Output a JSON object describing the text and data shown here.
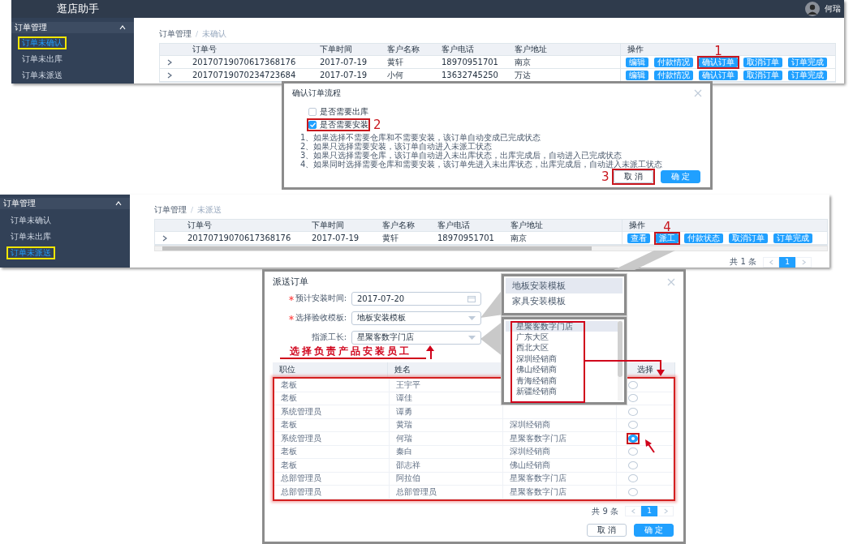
{
  "order_screen": {
    "app_title": "逛店助手",
    "user_name": "何瑞",
    "sidebar": {
      "group": "订单管理",
      "expanded": true,
      "items": [
        {
          "label": "订单未确认",
          "selected": true
        },
        {
          "label": "订单未出库",
          "selected": false
        },
        {
          "label": "订单未派送",
          "selected": false
        }
      ]
    },
    "breadcrumb": {
      "items": [
        "订单管理",
        "未确认"
      ],
      "separator": "/"
    },
    "columns": [
      "订单号",
      "下单时间",
      "客户名称",
      "客户电话",
      "客户地址",
      "操作"
    ],
    "rows": [
      {
        "order_no": "20170719070617368176",
        "date": "2017-07-19",
        "customer": "黄轩",
        "phone": "18970951701",
        "address": "南京",
        "actions": [
          {
            "label": "编辑",
            "highlighted": false
          },
          {
            "label": "付款情况",
            "highlighted": false
          },
          {
            "label": "确认订单",
            "highlighted": true,
            "step": "1"
          },
          {
            "label": "取消订单",
            "highlighted": false
          },
          {
            "label": "订单完成",
            "highlighted": false
          }
        ]
      },
      {
        "order_no": "20170719070234723684",
        "date": "2017-07-19",
        "customer": "小何",
        "phone": "13632745250",
        "address": "万达",
        "actions": [
          {
            "label": "编辑",
            "highlighted": false
          },
          {
            "label": "付款情况",
            "highlighted": false
          },
          {
            "label": "确认订单",
            "highlighted": false
          },
          {
            "label": "取消订单",
            "highlighted": false
          },
          {
            "label": "订单完成",
            "highlighted": false
          }
        ]
      }
    ]
  },
  "confirm_dialog": {
    "title": "确认订单流程",
    "options": [
      {
        "label": "是否需要出库",
        "checked": false,
        "highlighted": false
      },
      {
        "label": "是否需要安装",
        "checked": true,
        "highlighted": true,
        "step": "2"
      }
    ],
    "notes": [
      "1、如果选择不需要仓库和不需要安装，该订单自动变成已完成状态",
      "2、如果只选择需要安装，该订单自动进入未派工状态",
      "3、如果只选择需要仓库，该订单自动进入未出库状态，出库完成后，自动进入已完成状态",
      "4、如果同时选择需要仓库和需要安装，该订单先进入未出库状态，出库完成后，自动进入未派工状态"
    ],
    "buttons": [
      {
        "label": "取 消",
        "kind": "default",
        "highlighted": true,
        "step": "3"
      },
      {
        "label": "确 定",
        "kind": "primary",
        "highlighted": false
      }
    ]
  },
  "dispatch_screen": {
    "sidebar": {
      "group": "订单管理",
      "expanded": true,
      "items": [
        {
          "label": "订单未确认",
          "selected": false
        },
        {
          "label": "订单未出库",
          "selected": false
        },
        {
          "label": "订单未派送",
          "selected": true
        }
      ]
    },
    "breadcrumb": {
      "items": [
        "订单管理",
        "未派送"
      ],
      "separator": "/"
    },
    "columns": [
      "订单号",
      "下单时间",
      "客户名称",
      "客户电话",
      "客户地址",
      "操作"
    ],
    "rows": [
      {
        "order_no": "20170719070617368176",
        "date": "2017-07-19",
        "customer": "黄轩",
        "phone": "18970951701",
        "address": "南京",
        "actions": [
          {
            "label": "查看",
            "highlighted": false
          },
          {
            "label": "派工",
            "highlighted": true,
            "step": "4"
          },
          {
            "label": "付款状态",
            "highlighted": false
          },
          {
            "label": "取消订单",
            "highlighted": false
          },
          {
            "label": "订单完成",
            "highlighted": false
          }
        ]
      }
    ],
    "pagination": {
      "total": "共 1 条",
      "pages": [
        {
          "label": "1",
          "selected": true
        }
      ]
    }
  },
  "dispatch_dialog": {
    "title": "派送订单",
    "fields": [
      {
        "label": "预计安装时间:",
        "required": true,
        "kind": "date",
        "value": "2017-07-20"
      },
      {
        "label": "选择验收模板:",
        "required": true,
        "kind": "select",
        "value": "地板安装模板"
      },
      {
        "label": "指派工长:",
        "required": false,
        "kind": "select",
        "value": "星聚客数字门店"
      }
    ],
    "annotation": "选择负责产品安装员工",
    "columns": {
      "position": "职位",
      "name": "姓名",
      "choose": "选择"
    },
    "rows": [
      {
        "position": "老板",
        "name": "王宇平",
        "selected": false
      },
      {
        "position": "老板",
        "name": "谭佳",
        "selected": false
      },
      {
        "position": "系统管理员",
        "name": "谭勇",
        "selected": false
      },
      {
        "position": "老板",
        "name": "黄瑞",
        "store": "深圳经销商",
        "selected": false
      },
      {
        "position": "系统管理员",
        "name": "何瑞",
        "store": "星聚客数字门店",
        "selected": true
      },
      {
        "position": "老板",
        "name": "秦白",
        "store": "深圳经销商",
        "selected": false
      },
      {
        "position": "老板",
        "name": "邵志祥",
        "store": "佛山经销商",
        "selected": false
      },
      {
        "position": "总部管理员",
        "name": "阿拉伯",
        "store": "星聚客数字门店",
        "selected": false
      },
      {
        "position": "总部管理员",
        "name": "总部管理员",
        "store": "星聚客数字门店",
        "selected": false
      }
    ],
    "pagination": {
      "total": "共 9 条",
      "pages": [
        {
          "label": "1",
          "selected": true
        }
      ]
    },
    "buttons": [
      {
        "label": "取 消",
        "kind": "default",
        "highlighted": false
      },
      {
        "label": "确 定",
        "kind": "primary",
        "highlighted": false
      }
    ]
  },
  "template_dropdown": {
    "options": [
      {
        "label": "地板安装模板",
        "selected": true
      },
      {
        "label": "家具安装模板",
        "selected": false
      }
    ]
  },
  "foreman_dropdown": {
    "options": [
      {
        "label": "星聚客数字门店",
        "selected": true
      },
      {
        "label": "广东大区",
        "selected": false
      },
      {
        "label": "西北大区",
        "selected": false
      },
      {
        "label": "深圳经销商",
        "selected": false
      },
      {
        "label": "佛山经销商",
        "selected": false
      },
      {
        "label": "青海经销商",
        "selected": false
      },
      {
        "label": "新疆经销商",
        "selected": false
      }
    ]
  }
}
